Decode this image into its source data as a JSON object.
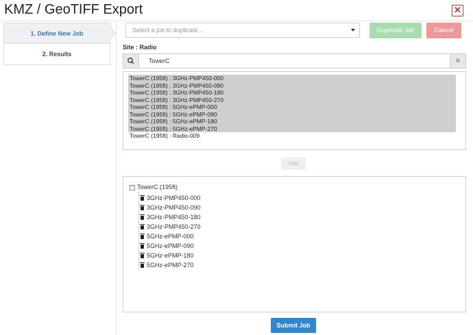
{
  "window": {
    "title": "KMZ / GeoTIFF Export",
    "close_symbol": "✕"
  },
  "steps": [
    {
      "label": "1. Define New Job",
      "active": true
    },
    {
      "label": "2. Results",
      "active": false
    }
  ],
  "duplicate": {
    "placeholder": "Select a job to duplicate...",
    "button_label": "Duplicate Job"
  },
  "cancel_label": "Cancel",
  "site_label": "Site : Radio",
  "search": {
    "value": "TowerC",
    "clear_symbol": "×"
  },
  "radio_list": [
    {
      "label": "TowerC (195ft) : 3GHz-PMP450-000",
      "selected": true
    },
    {
      "label": "TowerC (195ft) : 3GHz-PMP450-090",
      "selected": true
    },
    {
      "label": "TowerC (195ft) : 3GHz-PMP450-180",
      "selected": true
    },
    {
      "label": "TowerC (195ft) : 3GHz-PMP450-270",
      "selected": true
    },
    {
      "label": "TowerC (195ft) : 5GHz-ePMP-000",
      "selected": true
    },
    {
      "label": "TowerC (195ft) : 5GHz-ePMP-090",
      "selected": true
    },
    {
      "label": "TowerC (195ft) : 5GHz-ePMP-180",
      "selected": true
    },
    {
      "label": "TowerC (195ft) : 5GHz-ePMP-270",
      "selected": true
    },
    {
      "label": "TowerC (195ft) : Radio-009",
      "selected": false
    }
  ],
  "add_label": "Add",
  "tree": {
    "root": "TowerC (195ft)",
    "collapse_symbol": "−",
    "items": [
      "3GHz-PMP450-000",
      "3GHz-PMP450-090",
      "3GHz-PMP450-180",
      "3GHz-PMP450-270",
      "5GHz-ePMP-000",
      "5GHz-ePMP-090",
      "5GHz-ePMP-180",
      "5GHz-ePMP-270"
    ]
  },
  "submit_label": "Submit Job",
  "colors": {
    "accent": "#337ab7",
    "duplicate_button": "#a7dcb0",
    "cancel_button": "#ec9a99",
    "submit_button": "#2f86d1",
    "close_icon": "#c9302c",
    "selected_row": "#cfcfcf"
  },
  "icons": {
    "search": "search-icon",
    "close": "close-icon",
    "delete": "trash-icon",
    "collapse": "minus-box-icon"
  }
}
